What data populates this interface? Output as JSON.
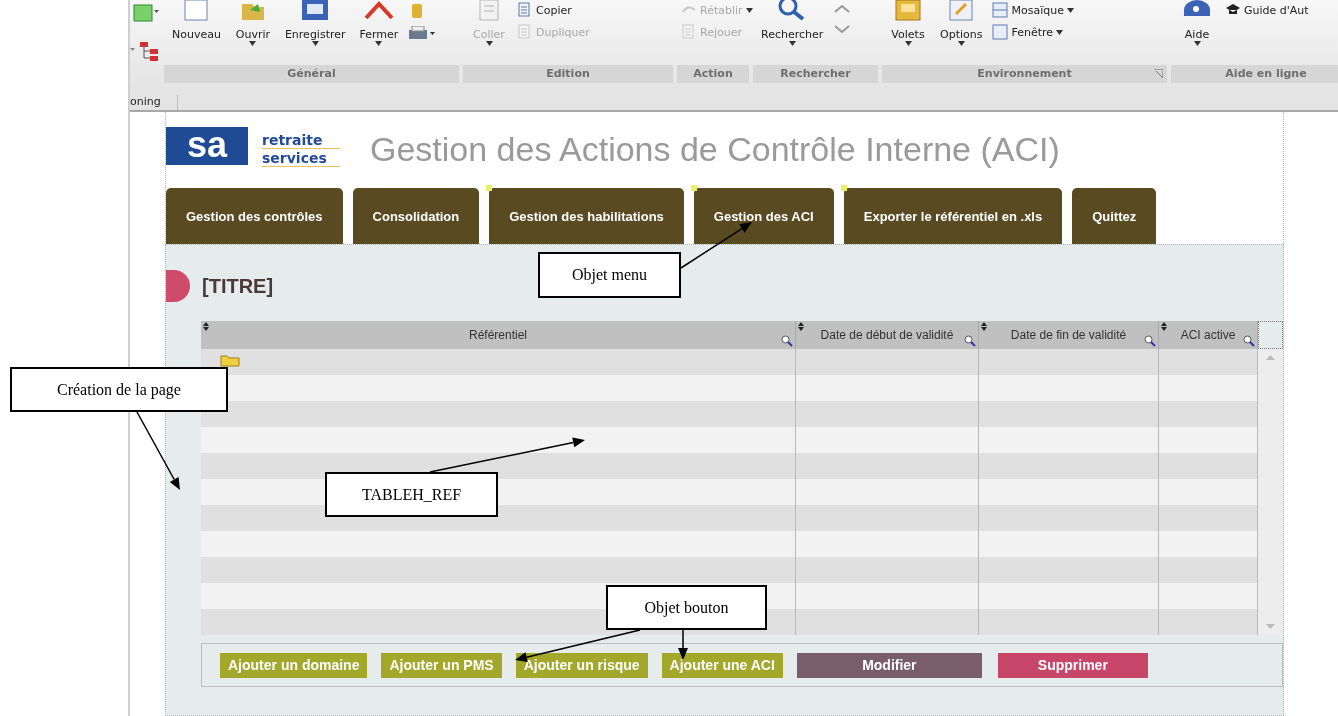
{
  "ribbon": {
    "groups": [
      {
        "label": "Général",
        "items": [
          {
            "label": "Nouveau",
            "kind": "large",
            "dropdown": false,
            "disabled": false
          },
          {
            "label": "Ouvrir",
            "kind": "large",
            "dropdown": true,
            "disabled": false
          },
          {
            "label": "Enregistrer",
            "kind": "large",
            "dropdown": true,
            "disabled": false
          },
          {
            "label": "Fermer",
            "kind": "large",
            "dropdown": true,
            "disabled": false
          }
        ]
      },
      {
        "label": "Edition",
        "items": [
          {
            "label": "Coller",
            "kind": "large",
            "dropdown": true,
            "disabled": true
          },
          {
            "label": "Copier",
            "kind": "small",
            "dropdown": false,
            "disabled": false
          },
          {
            "label": "Dupliquer",
            "kind": "small",
            "dropdown": false,
            "disabled": true
          }
        ]
      },
      {
        "label": "Action",
        "items": [
          {
            "label": "Rétablir",
            "kind": "small",
            "dropdown": true,
            "disabled": true
          },
          {
            "label": "Rejouer",
            "kind": "small",
            "dropdown": false,
            "disabled": true
          }
        ]
      },
      {
        "label": "Rechercher",
        "items": [
          {
            "label": "Rechercher",
            "kind": "large",
            "dropdown": true,
            "disabled": false
          }
        ]
      },
      {
        "label": "Environnement",
        "items": [
          {
            "label": "Volets",
            "kind": "large",
            "dropdown": true,
            "disabled": false
          },
          {
            "label": "Options",
            "kind": "large",
            "dropdown": true,
            "disabled": false
          },
          {
            "label": "Mosaïque",
            "kind": "small",
            "dropdown": true,
            "disabled": false
          },
          {
            "label": "Fenêtre",
            "kind": "small",
            "dropdown": true,
            "disabled": false
          }
        ]
      },
      {
        "label": "Aide en ligne",
        "items": [
          {
            "label": "Aide",
            "kind": "large",
            "dropdown": true,
            "disabled": false
          },
          {
            "label": "Guide d'Aut",
            "kind": "small",
            "dropdown": false,
            "disabled": false
          }
        ]
      }
    ],
    "tab_label": "oning"
  },
  "logo": {
    "mark": "sa",
    "line_1": "retraite",
    "line_2": "services"
  },
  "page_title": "Gestion des Actions de Contrôle Interne (ACI)",
  "menu": [
    {
      "label": "Gestion des contrôles",
      "marked": false
    },
    {
      "label": "Consolidation",
      "marked": false
    },
    {
      "label": "Gestion des habilitations",
      "marked": true
    },
    {
      "label": "Gestion des ACI",
      "marked": true
    },
    {
      "label": "Exporter le référentiel en .xls",
      "marked": true
    },
    {
      "label": "Quittez",
      "marked": false
    }
  ],
  "section_title": "[TITRE]",
  "table": {
    "columns": [
      {
        "label": "Référentiel"
      },
      {
        "label": "Date de début de validité"
      },
      {
        "label": "Date de fin de validité"
      },
      {
        "label": "ACI active"
      }
    ]
  },
  "buttons": [
    {
      "label": "Ajouter un domaine",
      "color": "#a3a82a"
    },
    {
      "label": "Ajouter un PMS",
      "color": "#a3a82a"
    },
    {
      "label": "Ajouter un risque",
      "color": "#a3a82a"
    },
    {
      "label": "Ajouter une ACI",
      "color": "#a3a82a"
    },
    {
      "label": "Modifier",
      "color": "#7a5d6a"
    },
    {
      "label": "Supprimer",
      "color": "#c8466a"
    }
  ],
  "annotations": [
    {
      "text": "Objet menu"
    },
    {
      "text": "Création de la page"
    },
    {
      "text": "TABLEH_REF"
    },
    {
      "text": "Objet bouton"
    }
  ]
}
